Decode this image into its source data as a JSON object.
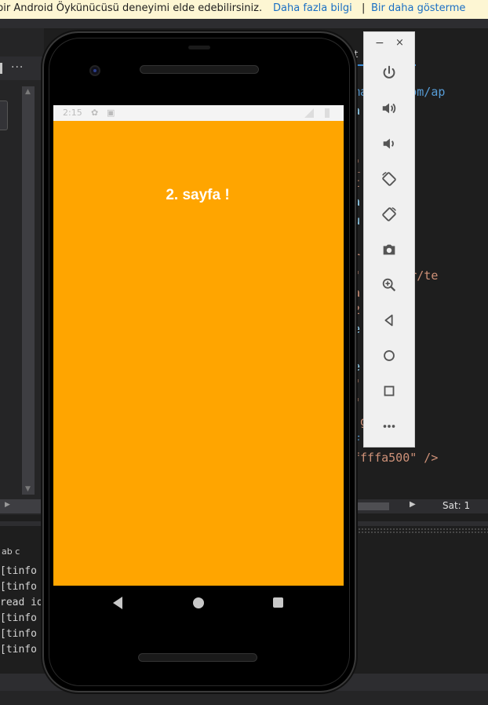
{
  "infobar": {
    "message": "bir Android Öykünücüsü deneyimi elde edebilirsiniz.",
    "link_more": "Daha fazla bilgi",
    "separator": "|",
    "link_dismiss": "Bir daha gösterme"
  },
  "ide": {
    "left_toolbar_dots": "...",
    "code_tab": "ut",
    "code_lines": [
      "ma     oid.com/ap",
      "a",
      "\"",
      "_     \"",
      "t     t\"",
      "a",
      "u",
      "r     n !\"",
      "\"     id:attr/te",
      "a     rent\"",
      "2     \"",
      "e",
      "e",
      "\"",
      "\"",
      ".g     0dp\"",
      "F",
      "ffffa500\" />"
    ],
    "cursor_label": "Sat: 1",
    "output_icon": "ab c",
    "output_lines": [
      "[tinfo",
      "[tinfo",
      "read id",
      "[tinfo",
      "[tinfo",
      "[tinfo"
    ]
  },
  "emulator": {
    "status_time": "2:15",
    "page_title": "2. sayfa !",
    "background_color": "#ffa500",
    "toolbar": {
      "minimize": "−",
      "close": "×",
      "buttons": [
        "power",
        "volume-up",
        "volume-down",
        "rotate-left",
        "rotate-right",
        "screenshot",
        "zoom",
        "back",
        "home",
        "overview",
        "more"
      ]
    }
  }
}
